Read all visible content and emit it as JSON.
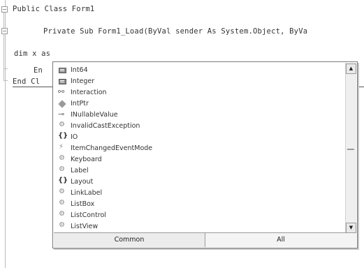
{
  "code": {
    "line1": "Public Class Form1",
    "line2": "Private Sub Form1_Load(ByVal sender As System.Object, ByVa",
    "line3": "dim x as",
    "line4": "En",
    "line5": "End Cl"
  },
  "intellisense": {
    "items": [
      {
        "label": "Int64",
        "icon": "enum-icon"
      },
      {
        "label": "Integer",
        "icon": "enum-icon"
      },
      {
        "label": "Interaction",
        "icon": "interface-icon"
      },
      {
        "label": "IntPtr",
        "icon": "structure-icon"
      },
      {
        "label": "INullableValue",
        "icon": "lollipop-interface-icon"
      },
      {
        "label": "InvalidCastException",
        "icon": "class-icon"
      },
      {
        "label": "IO",
        "icon": "namespace-icon"
      },
      {
        "label": "ItemChangedEventMode",
        "icon": "event-icon"
      },
      {
        "label": "Keyboard",
        "icon": "class-icon"
      },
      {
        "label": "Label",
        "icon": "class-icon"
      },
      {
        "label": "Layout",
        "icon": "namespace-icon"
      },
      {
        "label": "LinkLabel",
        "icon": "class-icon"
      },
      {
        "label": "ListBox",
        "icon": "class-icon"
      },
      {
        "label": "ListControl",
        "icon": "class-icon"
      },
      {
        "label": "ListView",
        "icon": "class-icon"
      }
    ],
    "tabs": {
      "common": "Common",
      "all": "All"
    },
    "scroll_up": "▲",
    "scroll_down": "▼"
  }
}
